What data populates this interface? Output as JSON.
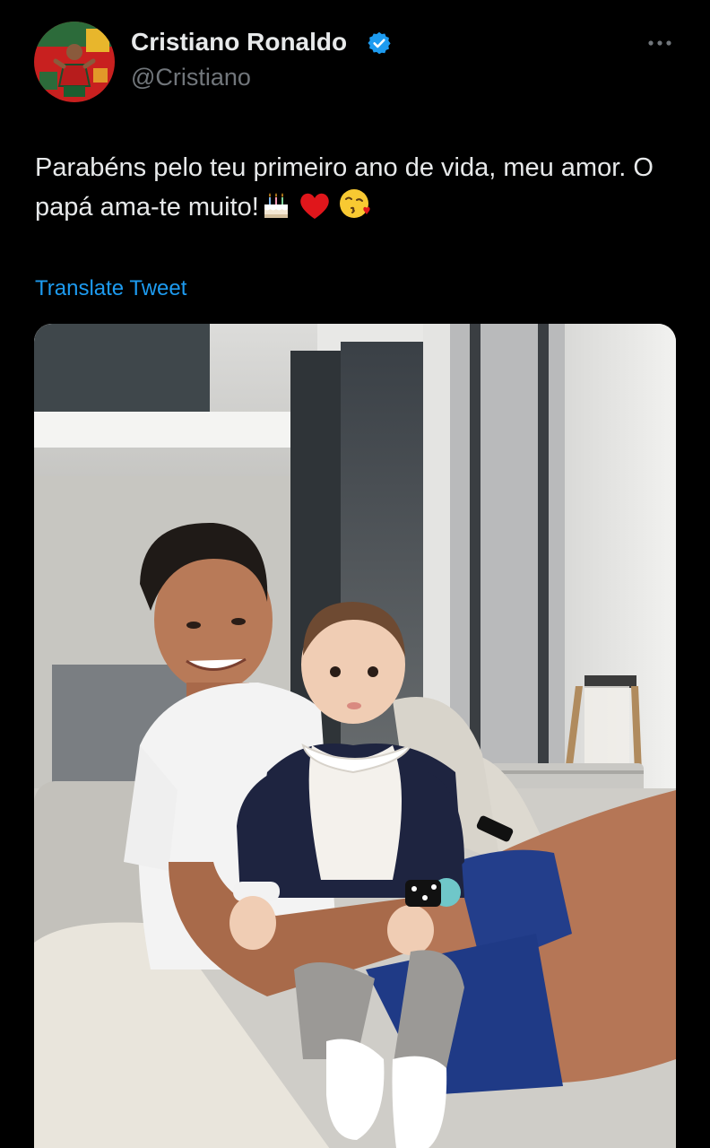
{
  "tweet": {
    "author": {
      "name": "Cristiano Ronaldo",
      "handle": "@Cristiano",
      "verified": true,
      "avatar_icon": "profile-avatar"
    },
    "text": "Parabéns pelo teu primeiro ano de vida, meu amor. O papá ama-te muito!",
    "emojis": [
      "birthday-cake-icon",
      "red-heart-icon",
      "face-blowing-kiss-icon"
    ],
    "translate_label": "Translate Tweet",
    "more_icon": "ellipsis-icon",
    "media": {
      "icon": "photo-icon"
    }
  },
  "colors": {
    "background": "#000000",
    "text_primary": "#e7e9ea",
    "text_secondary": "#71767b",
    "accent": "#1d9bf0",
    "verified_badge": "#1d9bf0"
  }
}
